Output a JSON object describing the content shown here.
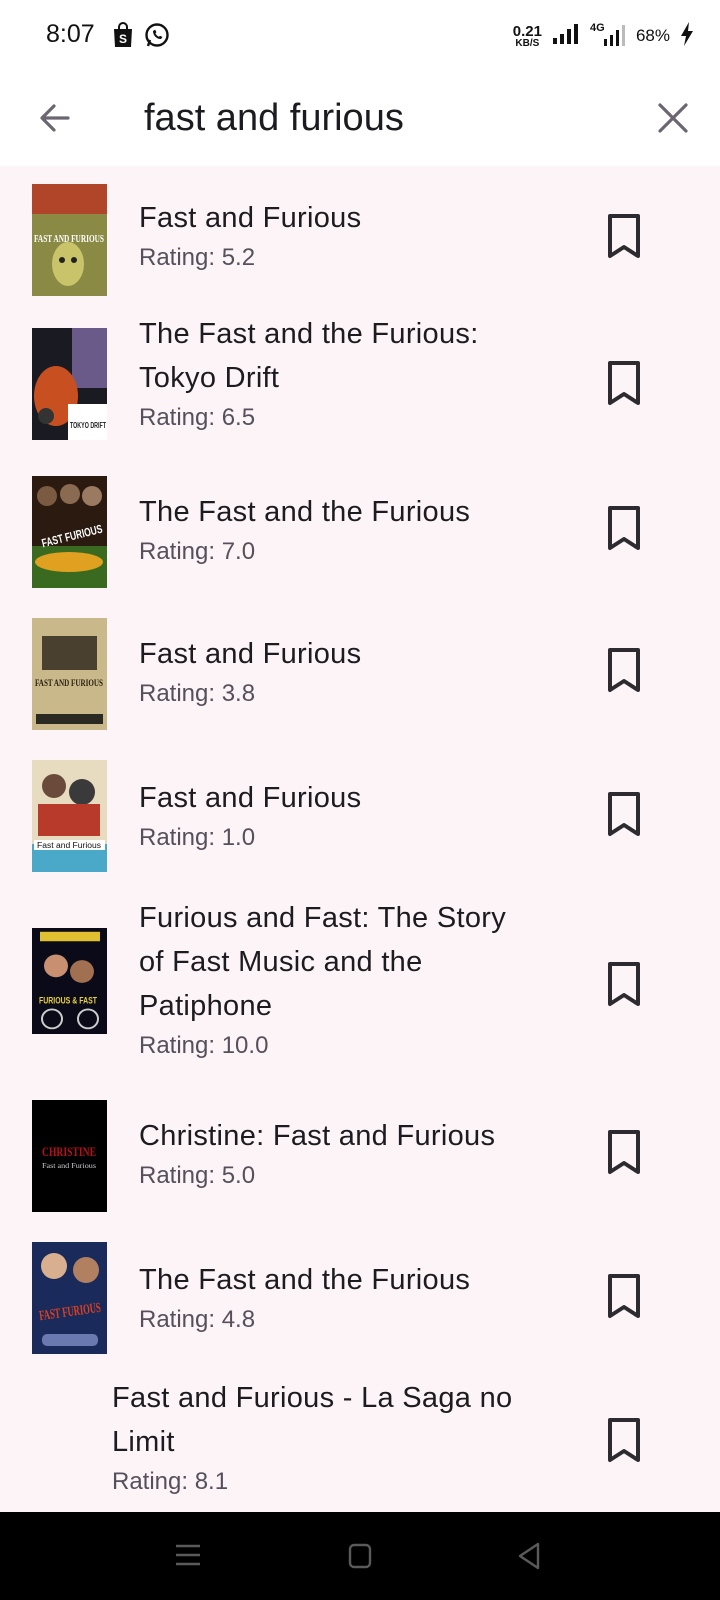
{
  "status_bar": {
    "time": "8:07",
    "net_speed": "0.21",
    "net_unit": "KB/S",
    "network": "4G",
    "battery": "68%"
  },
  "search": {
    "query": "fast and furious",
    "back_icon": "arrow-left-icon",
    "clear_icon": "close-icon"
  },
  "results": [
    {
      "title": "Fast and Furious",
      "rating": "Rating: 5.2"
    },
    {
      "title": "The Fast and the Furious: Tokyo Drift",
      "rating": "Rating: 6.5"
    },
    {
      "title": "The Fast and the Furious",
      "rating": "Rating: 7.0"
    },
    {
      "title": "Fast and Furious",
      "rating": "Rating: 3.8"
    },
    {
      "title": "Fast and Furious",
      "rating": "Rating: 1.0"
    },
    {
      "title": "Furious and Fast: The Story of Fast Music and the Patiphone",
      "rating": "Rating: 10.0"
    },
    {
      "title": "Christine: Fast and Furious",
      "rating": "Rating: 5.0"
    },
    {
      "title": "The Fast and the Furious",
      "rating": "Rating: 4.8"
    },
    {
      "title": "Fast and Furious - La Saga no Limit",
      "rating": "Rating: 8.1"
    }
  ],
  "poster_text": {
    "p1": "FAST AND FURIOUS",
    "p2": "TOKYO DRIFT",
    "p3": "FAST FURIOUS",
    "p4": "FAST AND FURIOUS",
    "p5": "Fast and Furious",
    "p6": "FURIOUS & FAST",
    "p7": "CHRISTINE",
    "p7b": "Fast and Furious",
    "p8": "FAST FURIOUS"
  },
  "colors": {
    "background": "#fdf4f7",
    "bar": "#ffffff",
    "text": "#1c1b1f",
    "subtext": "#55505c"
  }
}
